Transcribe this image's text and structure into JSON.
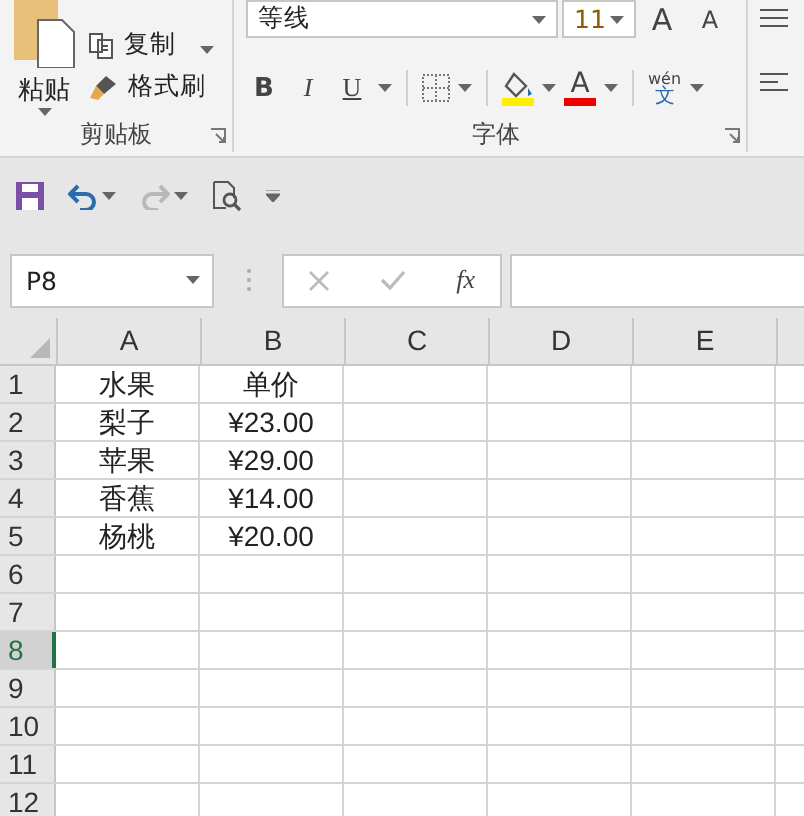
{
  "ribbon": {
    "clipboard": {
      "paste_label": "粘贴",
      "items": [
        {
          "kind": "copy",
          "label": "复制"
        },
        {
          "kind": "brush",
          "label": "格式刷"
        }
      ],
      "group_label": "剪贴板"
    },
    "font": {
      "font_name": "等线",
      "font_size": "11",
      "grow": "A",
      "shrink": "A",
      "styles": [
        "B",
        "I",
        "U"
      ],
      "font_color": "A",
      "phonetic_top": "wén",
      "phonetic_bottom": "文",
      "group_label": "字体"
    }
  },
  "quick_access": [
    {
      "kind": "save",
      "disabled": false
    },
    {
      "kind": "undo",
      "disabled": false
    },
    {
      "kind": "redo",
      "disabled": true
    },
    {
      "kind": "preview",
      "disabled": false
    }
  ],
  "formula_bar": {
    "name_box": "P8",
    "fx": "fx"
  },
  "sheet": {
    "columns": [
      "A",
      "B",
      "C",
      "D",
      "E"
    ],
    "rows": [
      {
        "number": "1",
        "selected": false,
        "cells": [
          "水果",
          "单价"
        ]
      },
      {
        "number": "2",
        "selected": false,
        "cells": [
          "梨子",
          "¥23.00"
        ]
      },
      {
        "number": "3",
        "selected": false,
        "cells": [
          "苹果",
          "¥29.00"
        ]
      },
      {
        "number": "4",
        "selected": false,
        "cells": [
          "香蕉",
          "¥14.00"
        ]
      },
      {
        "number": "5",
        "selected": false,
        "cells": [
          "杨桃",
          "¥20.00"
        ]
      },
      {
        "number": "6",
        "selected": false,
        "cells": []
      },
      {
        "number": "7",
        "selected": false,
        "cells": []
      },
      {
        "number": "8",
        "selected": true,
        "cells": []
      },
      {
        "number": "9",
        "selected": false,
        "cells": []
      },
      {
        "number": "10",
        "selected": false,
        "cells": []
      },
      {
        "number": "11",
        "selected": false,
        "cells": []
      },
      {
        "number": "12",
        "selected": false,
        "cells": []
      }
    ]
  }
}
